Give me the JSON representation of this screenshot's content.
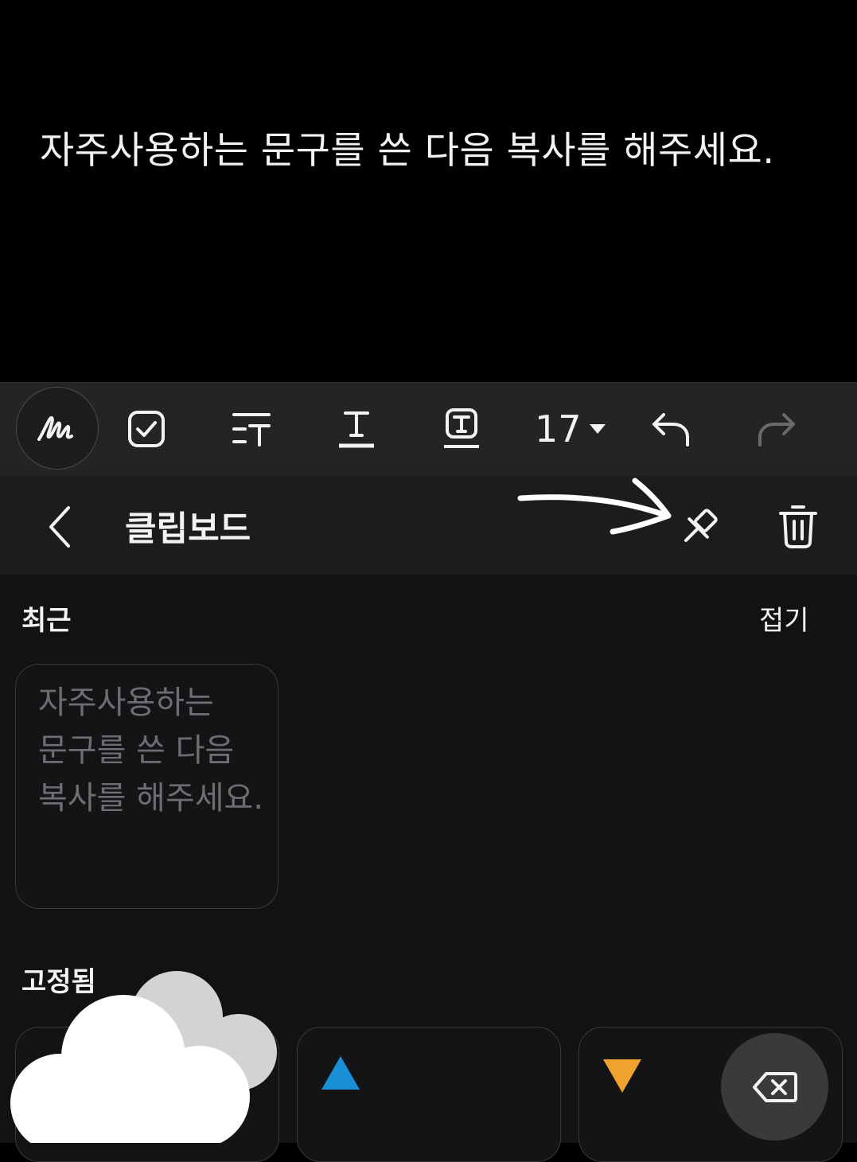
{
  "note": {
    "text": "자주사용하는 문구를 쓴 다음 복사를 해주세요."
  },
  "toolbar": {
    "font_size": "17",
    "tools": [
      "handwriting-icon",
      "checkbox-icon",
      "text-style-icon",
      "text-format-icon",
      "text-box-icon",
      "undo-icon",
      "redo-icon"
    ]
  },
  "clipboard": {
    "title": "클립보드",
    "recent_label": "최근",
    "fold_label": "접기",
    "recent_items": [
      {
        "text": "자주사용하는 문구를 쓴 다음 복사를 해주세요."
      }
    ],
    "pinned_label": "고정됨",
    "pinned_items": [
      {
        "icon": "cloud-icon"
      },
      {
        "icon": "triangle-up-icon",
        "color": "#1a8fd6"
      },
      {
        "icon": "triangle-down-icon",
        "color": "#f0a22e"
      }
    ]
  },
  "colors": {
    "toolbar_bg": "#242426",
    "header_bg": "#1c1c1e",
    "panel_bg": "#111214",
    "accent_blue": "#1a8fd6",
    "accent_orange": "#f0a22e"
  }
}
